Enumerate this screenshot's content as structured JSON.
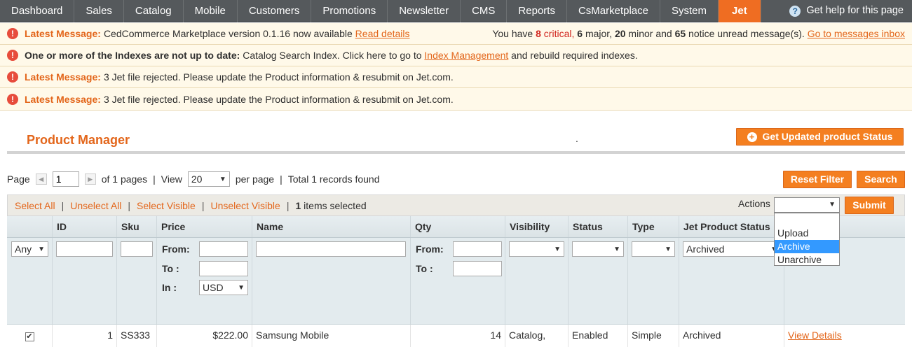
{
  "nav": {
    "items": [
      "Dashboard",
      "Sales",
      "Catalog",
      "Mobile",
      "Customers",
      "Promotions",
      "Newsletter",
      "CMS",
      "Reports",
      "CsMarketplace",
      "System",
      "Jet"
    ],
    "active": "Jet",
    "help": "Get help for this page"
  },
  "messages": [
    {
      "label": "Latest Message:",
      "text": "CedCommerce Marketplace version 0.1.16 now available",
      "link": "Read details",
      "right": {
        "pre": "You have",
        "critical_count": "8",
        "critical": "critical,",
        "major_count": "6",
        "major": "major,",
        "minor_count": "20",
        "minor": "minor and",
        "notice_count": "65",
        "notice": "notice unread message(s).",
        "link": "Go to messages inbox"
      }
    },
    {
      "label": "One or more of the Indexes are not up to date:",
      "text": "Catalog Search Index. Click here to go to",
      "link": "Index Management",
      "after": "and rebuild required indexes."
    },
    {
      "label": "Latest Message:",
      "text": "3 Jet file rejected. Please update the Product information & resubmit on Jet.com."
    },
    {
      "label": "Latest Message:",
      "text": "3 Jet file rejected. Please update the Product information & resubmit on Jet.com."
    }
  ],
  "page": {
    "title": "Product Manager",
    "dot": ".",
    "get_status_button": "Get Updated product Status",
    "reset_button": "Reset Filter",
    "search_button": "Search"
  },
  "pager": {
    "page_label": "Page",
    "page_value": "1",
    "of_pages": "of 1 pages",
    "sep": "|",
    "view_label": "View",
    "view_value": "20",
    "per_page": "per page",
    "total": "Total 1 records found"
  },
  "mass": {
    "select_all": "Select All",
    "unselect_all": "Unselect All",
    "select_visible": "Select Visible",
    "unselect_visible": "Unselect Visible",
    "count": "1",
    "selected": "items selected",
    "actions_label": "Actions",
    "actions_value": "",
    "submit": "Submit",
    "options": [
      "",
      "Upload",
      "Archive",
      "Unarchive"
    ],
    "highlighted": "Archive"
  },
  "grid": {
    "headers": [
      "",
      "ID",
      "Sku",
      "Price",
      "Name",
      "Qty",
      "Visibility",
      "Status",
      "Type",
      "Jet Product Status",
      ""
    ],
    "filters": {
      "massaction": "Any",
      "from_label": "From:",
      "to_label": "To :",
      "in_label": "In :",
      "currency": "USD",
      "jet_status": "Archived"
    },
    "rows": [
      {
        "checked": true,
        "id": "1",
        "sku": "SS333",
        "price": "$222.00",
        "name": "Samsung Mobile",
        "qty": "14",
        "visibility": "Catalog, Search",
        "status": "Enabled",
        "type": "Simple Product",
        "jet_status": "Archived",
        "action": "View Details"
      }
    ]
  }
}
